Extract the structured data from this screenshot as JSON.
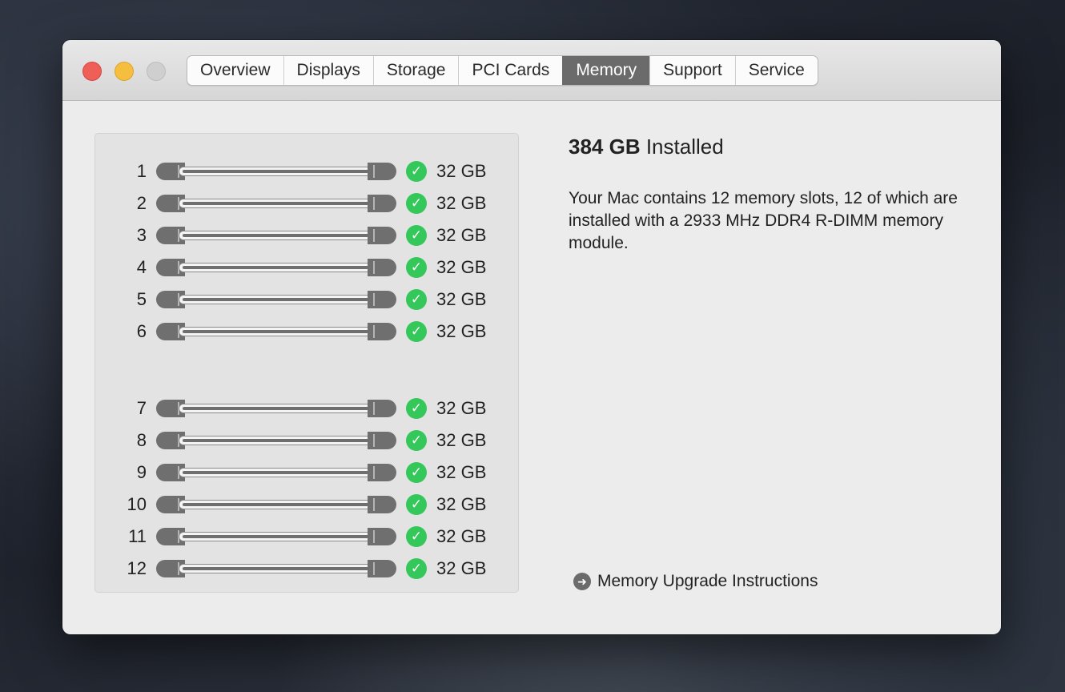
{
  "window": {
    "tabs": [
      {
        "label": "Overview",
        "active": false
      },
      {
        "label": "Displays",
        "active": false
      },
      {
        "label": "Storage",
        "active": false
      },
      {
        "label": "PCI Cards",
        "active": false
      },
      {
        "label": "Memory",
        "active": true
      },
      {
        "label": "Support",
        "active": false
      },
      {
        "label": "Service",
        "active": false
      }
    ]
  },
  "memory": {
    "total_bold": "384 GB",
    "total_suffix": " Installed",
    "description": "Your Mac contains 12 memory slots, 12 of which are installed with a 2933 MHz DDR4 R-DIMM memory module.",
    "slots": [
      {
        "number": "1",
        "size": "32 GB",
        "status": "ok"
      },
      {
        "number": "2",
        "size": "32 GB",
        "status": "ok"
      },
      {
        "number": "3",
        "size": "32 GB",
        "status": "ok"
      },
      {
        "number": "4",
        "size": "32 GB",
        "status": "ok"
      },
      {
        "number": "5",
        "size": "32 GB",
        "status": "ok"
      },
      {
        "number": "6",
        "size": "32 GB",
        "status": "ok"
      },
      {
        "number": "7",
        "size": "32 GB",
        "status": "ok"
      },
      {
        "number": "8",
        "size": "32 GB",
        "status": "ok"
      },
      {
        "number": "9",
        "size": "32 GB",
        "status": "ok"
      },
      {
        "number": "10",
        "size": "32 GB",
        "status": "ok"
      },
      {
        "number": "11",
        "size": "32 GB",
        "status": "ok"
      },
      {
        "number": "12",
        "size": "32 GB",
        "status": "ok"
      }
    ],
    "upgrade_link": "Memory Upgrade Instructions",
    "upgrade_icon": "arrow-circle-right-icon",
    "status_color": "#34c759"
  }
}
